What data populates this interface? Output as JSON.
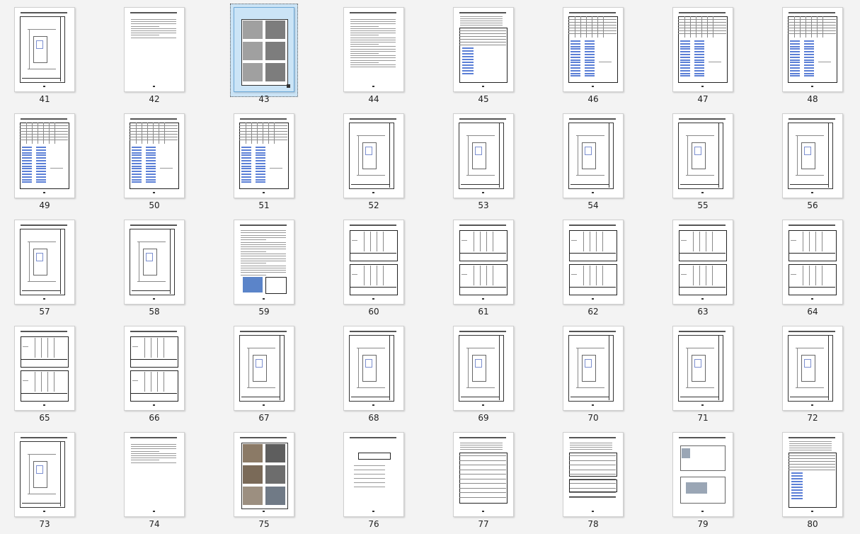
{
  "thumbnails": [
    {
      "n": "41",
      "kind": "plan"
    },
    {
      "n": "42",
      "kind": "text"
    },
    {
      "n": "43",
      "kind": "photos",
      "selected": true
    },
    {
      "n": "44",
      "kind": "text2"
    },
    {
      "n": "45",
      "kind": "table"
    },
    {
      "n": "46",
      "kind": "bluetable"
    },
    {
      "n": "47",
      "kind": "bluetable"
    },
    {
      "n": "48",
      "kind": "bluetable"
    },
    {
      "n": "49",
      "kind": "bluetable"
    },
    {
      "n": "50",
      "kind": "bluetable"
    },
    {
      "n": "51",
      "kind": "bluetable"
    },
    {
      "n": "52",
      "kind": "plan"
    },
    {
      "n": "53",
      "kind": "plan"
    },
    {
      "n": "54",
      "kind": "plan"
    },
    {
      "n": "55",
      "kind": "plan"
    },
    {
      "n": "56",
      "kind": "plan"
    },
    {
      "n": "57",
      "kind": "plan"
    },
    {
      "n": "58",
      "kind": "plan"
    },
    {
      "n": "59",
      "kind": "textimg"
    },
    {
      "n": "60",
      "kind": "grid"
    },
    {
      "n": "61",
      "kind": "grid"
    },
    {
      "n": "62",
      "kind": "grid"
    },
    {
      "n": "63",
      "kind": "grid"
    },
    {
      "n": "64",
      "kind": "grid"
    },
    {
      "n": "65",
      "kind": "grid"
    },
    {
      "n": "66",
      "kind": "grid"
    },
    {
      "n": "67",
      "kind": "plan"
    },
    {
      "n": "68",
      "kind": "plan"
    },
    {
      "n": "69",
      "kind": "plan"
    },
    {
      "n": "70",
      "kind": "plan"
    },
    {
      "n": "71",
      "kind": "plan"
    },
    {
      "n": "72",
      "kind": "plan"
    },
    {
      "n": "73",
      "kind": "plan"
    },
    {
      "n": "74",
      "kind": "text"
    },
    {
      "n": "75",
      "kind": "photos6"
    },
    {
      "n": "76",
      "kind": "cover"
    },
    {
      "n": "77",
      "kind": "form"
    },
    {
      "n": "78",
      "kind": "form2"
    },
    {
      "n": "79",
      "kind": "planpair"
    },
    {
      "n": "80",
      "kind": "table"
    }
  ],
  "colors": {
    "selection": "#cbe4f6",
    "background": "#f3f3f3",
    "link_blue": "#5b7fd6"
  }
}
